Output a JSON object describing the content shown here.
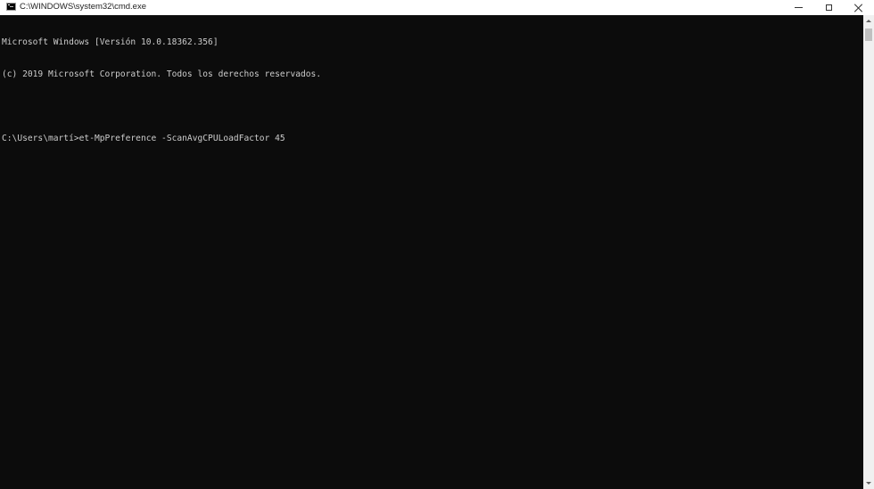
{
  "window": {
    "title": "C:\\WINDOWS\\system32\\cmd.exe",
    "icon": "cmd-icon"
  },
  "controls": {
    "minimize_icon": "minimize-icon",
    "maximize_icon": "maximize-icon",
    "close_icon": "close-icon"
  },
  "console": {
    "lines": [
      "Microsoft Windows [Versión 10.0.18362.356]",
      "(c) 2019 Microsoft Corporation. Todos los derechos reservados.",
      "",
      "C:\\Users\\martí>et-MpPreference -ScanAvgCPULoadFactor 45"
    ],
    "background": "#0c0c0c",
    "foreground": "#cccccc"
  }
}
